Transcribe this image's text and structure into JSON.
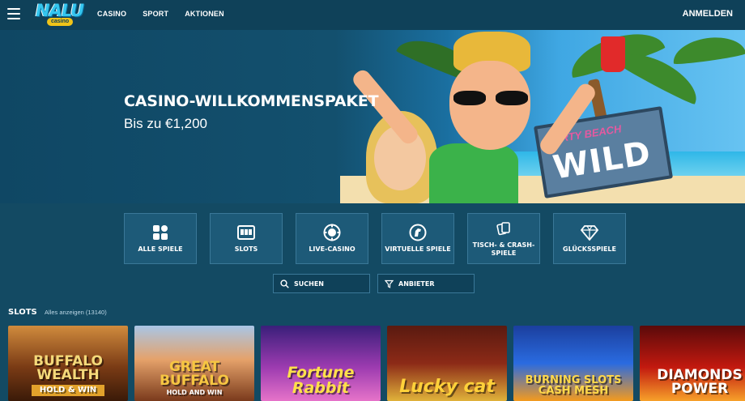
{
  "header": {
    "logo_main": "NALU",
    "logo_sub": "casino",
    "nav": [
      "CASINO",
      "SPORT",
      "AKTIONEN"
    ],
    "login_label": "ANMELDEN"
  },
  "hero": {
    "title": "CASINO-WILLKOMMENSPAKET",
    "subtitle": "Bis zu €1,200",
    "sign_top": "PARTY BEACH",
    "sign_main": "WILD"
  },
  "categories": [
    {
      "label": "ALLE SPIELE",
      "icon": "grid-icon"
    },
    {
      "label": "SLOTS",
      "icon": "slot-machine-icon"
    },
    {
      "label": "LIVE-CASINO",
      "icon": "poker-chip-icon"
    },
    {
      "label": "VIRTUELLE SPIELE",
      "icon": "horse-icon"
    },
    {
      "label": "TISCH- & CRASH-SPIELE",
      "icon": "cards-icon"
    },
    {
      "label": "GLÜCKSSPIELE",
      "icon": "diamond-icon"
    }
  ],
  "filters": {
    "search_label": "SUCHEN",
    "provider_label": "ANBIETER"
  },
  "slots": {
    "title": "SLOTS",
    "show_all": "Alles anzeigen (13140)",
    "games": [
      {
        "name": "BUFFALO WEALTH",
        "sub": "HOLD & WIN"
      },
      {
        "name": "GREAT BUFFALO",
        "sub": "HOLD AND WIN"
      },
      {
        "name": "Fortune Rabbit",
        "sub": ""
      },
      {
        "name": "Lucky cat",
        "sub": ""
      },
      {
        "name": "BURNING SLOTS CASH MESH",
        "sub": ""
      },
      {
        "name": "DIAMONDS POWER",
        "sub": ""
      }
    ]
  },
  "colors": {
    "background": "#134a63",
    "header": "#0f4159",
    "tile": "#1d5a78",
    "tile_border": "#3a7898"
  }
}
